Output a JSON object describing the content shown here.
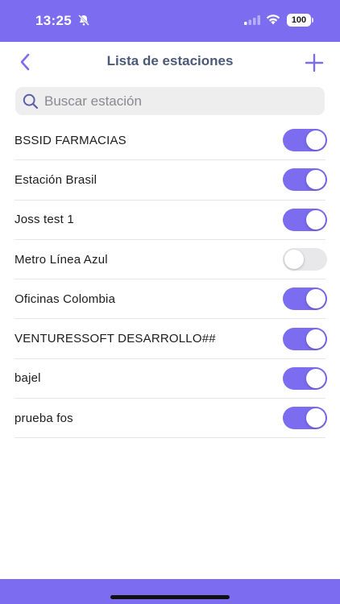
{
  "status_bar": {
    "time": "13:25",
    "battery": "100",
    "icons": [
      "bell-slash-icon",
      "signal-icon",
      "wifi-icon",
      "battery-icon"
    ]
  },
  "nav": {
    "title": "Lista de estaciones",
    "back_icon": "chevron-left-icon",
    "add_icon": "plus-icon"
  },
  "search": {
    "placeholder": "Buscar estación",
    "value": ""
  },
  "stations": [
    {
      "name": "BSSID FARMACIAS",
      "enabled": true
    },
    {
      "name": "Estación Brasil",
      "enabled": true
    },
    {
      "name": "Joss test 1",
      "enabled": true
    },
    {
      "name": "Metro Línea Azul",
      "enabled": false
    },
    {
      "name": "Oficinas Colombia",
      "enabled": true
    },
    {
      "name": "VENTURESSOFT DESARROLLO##",
      "enabled": true
    },
    {
      "name": "bajel",
      "enabled": true
    },
    {
      "name": "prueba fos",
      "enabled": true
    }
  ],
  "colors": {
    "accent": "#7b6cf0",
    "title": "#4a5a78",
    "toggle_off": "#e8e8ea"
  }
}
